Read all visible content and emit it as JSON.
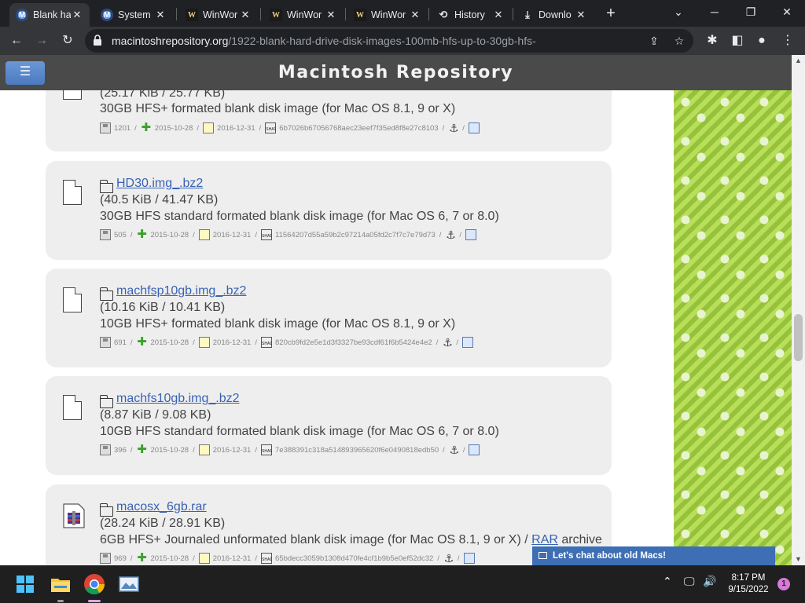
{
  "browser": {
    "tabs": [
      {
        "title": "Blank ha",
        "favicon": "macintosh-repository-icon",
        "active": true
      },
      {
        "title": "System",
        "favicon": "macintosh-repository-icon",
        "active": false
      },
      {
        "title": "WinWor",
        "favicon": "winworld-icon",
        "active": false
      },
      {
        "title": "WinWor",
        "favicon": "winworld-icon",
        "active": false
      },
      {
        "title": "WinWor",
        "favicon": "winworld-icon",
        "active": false
      },
      {
        "title": "History",
        "favicon": "history-icon",
        "active": false
      },
      {
        "title": "Downlo",
        "favicon": "download-icon",
        "active": false
      }
    ],
    "url_domain": "macintoshrepository.org",
    "url_path": "/1922-blank-hard-drive-disk-images-100mb-hfs-up-to-30gb-hfs-"
  },
  "site": {
    "title": "Macintosh Repository",
    "menu_icon": "hamburger-icon"
  },
  "files": [
    {
      "name": "",
      "size": "(25.17 KiB / 25.77 KB)",
      "description": "30GB HFS+ formated blank disk image (for Mac OS 8.1, 9 or X)",
      "downloads": "1201",
      "added": "2015-10-28",
      "updated": "2016-12-31",
      "sha": "6b7026b67056768aec23eef7f35ed8f8e27c8103"
    },
    {
      "name": "HD30.img_.bz2",
      "size": "(40.5 KiB / 41.47 KB)",
      "description": "30GB HFS standard formated blank disk image (for Mac OS 6, 7 or 8.0)",
      "downloads": "505",
      "added": "2015-10-28",
      "updated": "2016-12-31",
      "sha": "11564207d55a59b2c97214a05fd2c7f7c7e79d73"
    },
    {
      "name": "machfsp10gb.img_.bz2",
      "size": "(10.16 KiB / 10.41 KB)",
      "description": "10GB HFS+ formated blank disk image (for Mac OS 8.1, 9 or X)",
      "downloads": "691",
      "added": "2015-10-28",
      "updated": "2016-12-31",
      "sha": "820cb9fd2e5e1d3f3327be93cdf61f6b5424e4e2"
    },
    {
      "name": "machfs10gb.img_.bz2",
      "size": "(8.87 KiB / 9.08 KB)",
      "description": "10GB HFS standard formated blank disk image (for Mac OS 6, 7 or 8.0)",
      "downloads": "396",
      "added": "2015-10-28",
      "updated": "2016-12-31",
      "sha": "7e388391c318a514893965620f6e0490818edb50"
    },
    {
      "name": "macosx_6gb.rar",
      "size": "(28.24 KiB / 28.91 KB)",
      "description": "6GB HFS+ Journaled unformated blank disk image (for Mac OS 8.1, 9 or X) /",
      "desc_link": "RAR",
      "desc_tail": "archive",
      "downloads": "969",
      "added": "2015-10-28",
      "updated": "2016-12-31",
      "sha": "65bdecc3059b1308d470fe4cf1b9b5e0ef52dc32"
    }
  ],
  "chat": {
    "label": "Let's chat about old Macs!"
  },
  "taskbar": {
    "time": "8:17 PM",
    "date": "9/15/2022",
    "notifications": "1"
  }
}
